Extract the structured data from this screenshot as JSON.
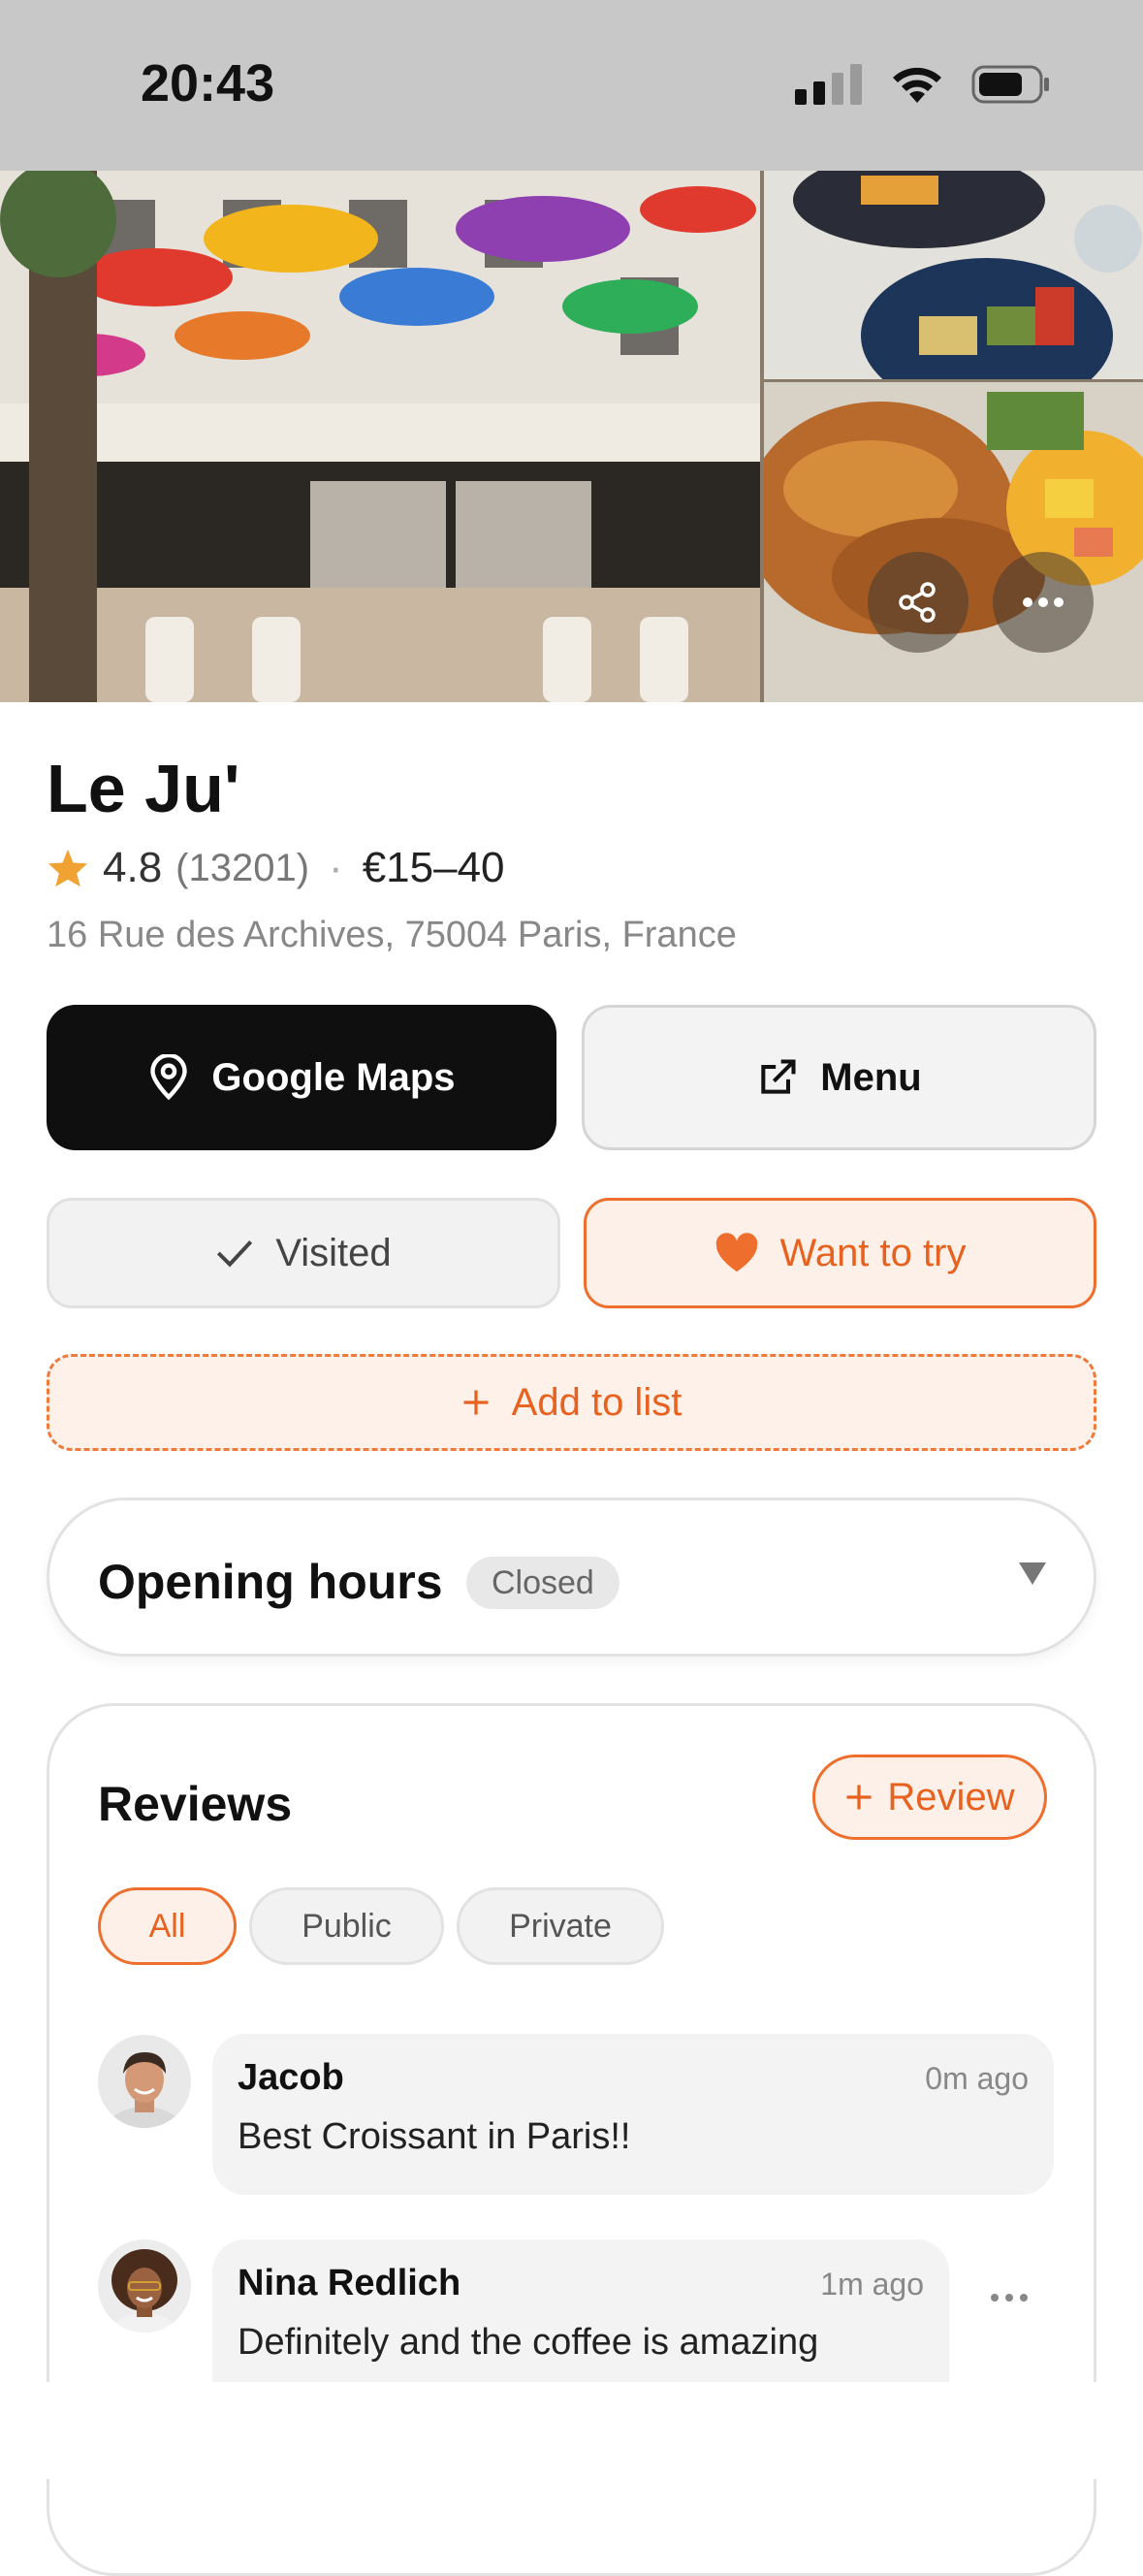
{
  "status": {
    "time": "20:43"
  },
  "hero": {
    "main_photo": "cafe-terrace-with-rainbow-umbrellas",
    "side_photo_top": "plate-with-fries-and-salad",
    "side_photo_bottom": "croissants-and-fruit",
    "share_icon": "share-icon",
    "more_icon": "more-horizontal-icon"
  },
  "place": {
    "name": "Le Ju'",
    "rating": "4.8",
    "review_count": "(13201)",
    "separator": "·",
    "price": "€15–40",
    "address": "16 Rue des Archives, 75004 Paris, France"
  },
  "actions": {
    "maps_label": "Google Maps",
    "menu_label": "Menu",
    "visited_label": "Visited",
    "want_label": "Want to try",
    "add_list_label": "Add to list"
  },
  "hours": {
    "title": "Opening hours",
    "status": "Closed"
  },
  "reviews": {
    "title": "Reviews",
    "add_label": "Review",
    "filters": [
      "All",
      "Public",
      "Private"
    ],
    "items": [
      {
        "name": "Jacob",
        "time": "0m ago",
        "text": "Best Croissant in Paris!!"
      },
      {
        "name": "Nina Redlich",
        "time": "1m ago",
        "text": "Definitely and the coffee is amazing"
      }
    ]
  },
  "colors": {
    "accent": "#EE6F2D",
    "dark": "#0F0F0F",
    "star": "#F0A233"
  }
}
